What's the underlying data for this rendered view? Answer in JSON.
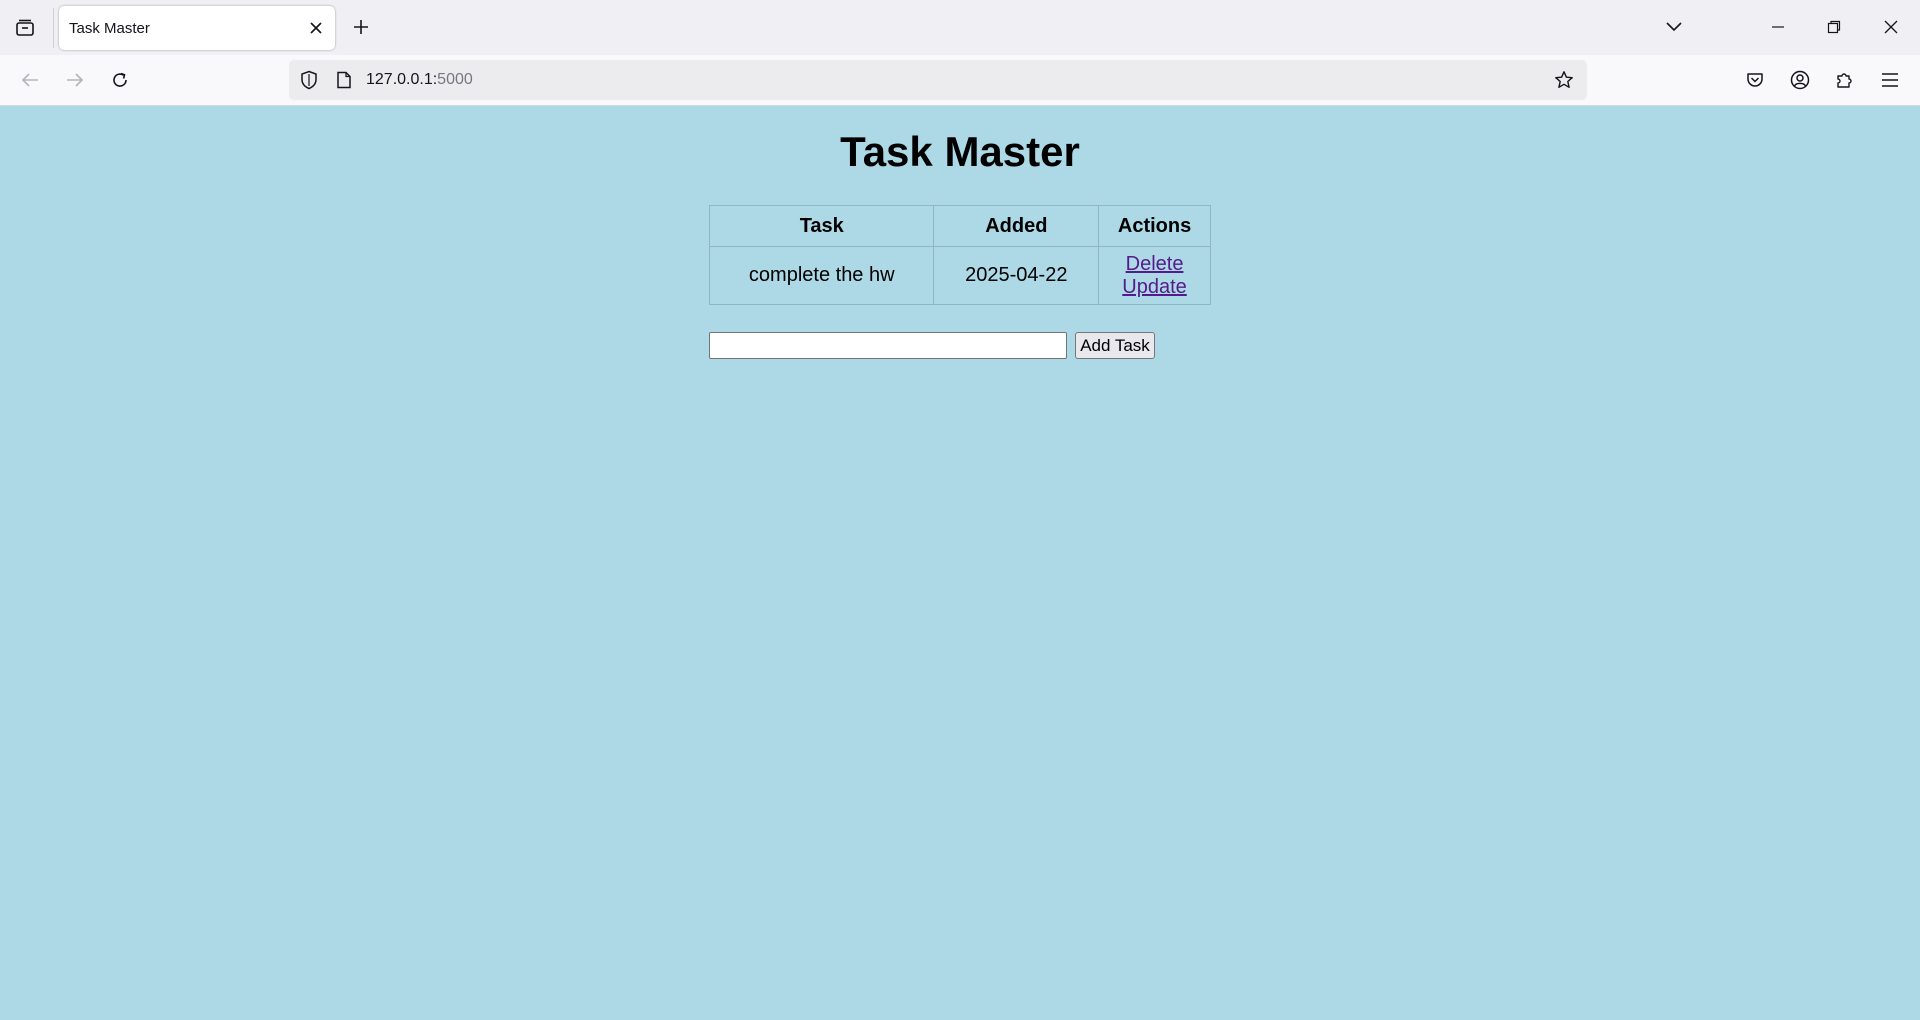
{
  "browser": {
    "tab": {
      "title": "Task Master"
    },
    "url": {
      "host": "127.0.0.1:",
      "port": "5000"
    },
    "icons": {
      "tab_list": "tab-list-icon",
      "tab_close": "close-icon",
      "new_tab": "plus-icon",
      "list_all_tabs": "chevron-down-icon",
      "minimize": "minimize-icon",
      "restore": "restore-icon",
      "close_window": "close-icon",
      "back": "back-arrow-icon",
      "forward": "forward-arrow-icon",
      "reload": "reload-icon",
      "shield": "shield-icon",
      "page": "page-icon",
      "bookmark": "star-icon",
      "pocket": "pocket-icon",
      "account": "account-icon",
      "extensions": "puzzle-icon",
      "menu": "hamburger-menu-icon"
    }
  },
  "page": {
    "title": "Task Master",
    "background": "#add8e6",
    "table": {
      "headers": [
        "Task",
        "Added",
        "Actions"
      ],
      "rows": [
        {
          "task": "complete the hw",
          "added": "2025-04-22",
          "delete_label": "Delete",
          "update_label": "Update"
        }
      ]
    },
    "form": {
      "input_value": "",
      "button_label": "Add Task"
    }
  }
}
